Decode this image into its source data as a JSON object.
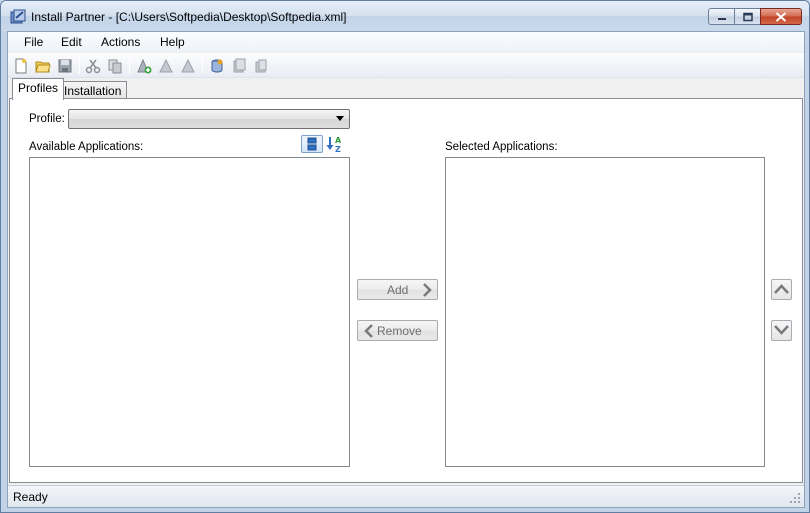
{
  "window": {
    "title": "Install Partner - [C:\\Users\\Softpedia\\Desktop\\Softpedia.xml]",
    "icon": "install-partner-app-icon"
  },
  "menu": [
    {
      "label": "File",
      "name": "menu-file"
    },
    {
      "label": "Edit",
      "name": "menu-edit"
    },
    {
      "label": "Actions",
      "name": "menu-actions"
    },
    {
      "label": "Help",
      "name": "menu-help"
    }
  ],
  "toolbar": {
    "icons": [
      "new-document-icon",
      "open-folder-icon",
      "save-disk-icon",
      "cut-icon",
      "copy-icon",
      "add-application-icon",
      "edit-application-icon",
      "remove-application-icon",
      "install-database-icon",
      "copy-files-icon",
      "paste-files-icon"
    ]
  },
  "tabs": [
    {
      "label": "Profiles",
      "active": true
    },
    {
      "label": "Installation",
      "active": false
    }
  ],
  "profiles": {
    "profile_label": "Profile:",
    "profile_value": "",
    "available_label": "Available Applications:",
    "selected_label": "Selected Applications:",
    "available_items": [],
    "selected_items": [],
    "add_label": "Add",
    "remove_label": "Remove"
  },
  "status": {
    "text": "Ready"
  },
  "colors": {
    "accent": "#3c7fc1",
    "sort_green": "#2e9a3a",
    "close_red": "#c34325"
  }
}
